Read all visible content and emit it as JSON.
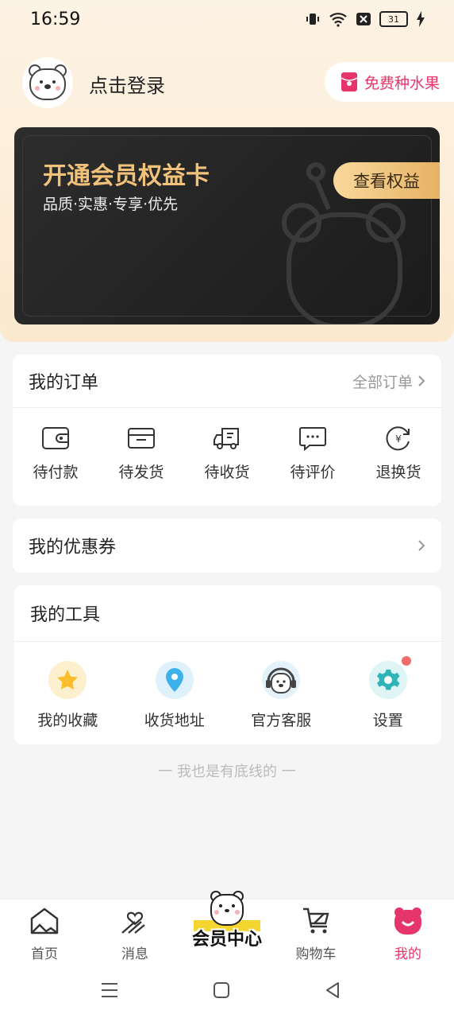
{
  "status": {
    "time": "16:59",
    "battery": "31"
  },
  "header": {
    "login_text": "点击登录",
    "fruit_label": "免费种水果"
  },
  "vip": {
    "title": "开通会员权益卡",
    "subtitle": "品质·实惠·专享·优先",
    "button": "查看权益"
  },
  "orders": {
    "title": "我的订单",
    "more": "全部订单",
    "items": [
      {
        "label": "待付款",
        "icon": "wallet-icon"
      },
      {
        "label": "待发货",
        "icon": "box-icon"
      },
      {
        "label": "待收货",
        "icon": "truck-icon"
      },
      {
        "label": "待评价",
        "icon": "chat-icon"
      },
      {
        "label": "退换货",
        "icon": "refund-icon"
      }
    ]
  },
  "coupons": {
    "title": "我的优惠券"
  },
  "tools": {
    "title": "我的工具",
    "items": [
      {
        "label": "我的收藏",
        "icon": "star-icon",
        "color": "#fbbd2a"
      },
      {
        "label": "收货地址",
        "icon": "location-pin-icon",
        "color": "#3fb1ea"
      },
      {
        "label": "官方客服",
        "icon": "headset-bear-icon",
        "color": "#6fb6e8"
      },
      {
        "label": "设置",
        "icon": "gear-icon",
        "color": "#2fb5b8"
      }
    ]
  },
  "footer_text": "一  我也是有底线的  一",
  "tabbar": {
    "items": [
      {
        "label": "首页",
        "icon": "home-icon"
      },
      {
        "label": "消息",
        "icon": "message-icon"
      },
      {
        "label": "会员中心",
        "icon": "bear-mascot-icon"
      },
      {
        "label": "购物车",
        "icon": "cart-icon"
      },
      {
        "label": "我的",
        "icon": "bear-face-icon"
      }
    ],
    "active_color": "#e6356b"
  },
  "colors": {
    "accent": "#e6356b",
    "gold": "#f3c27a"
  }
}
